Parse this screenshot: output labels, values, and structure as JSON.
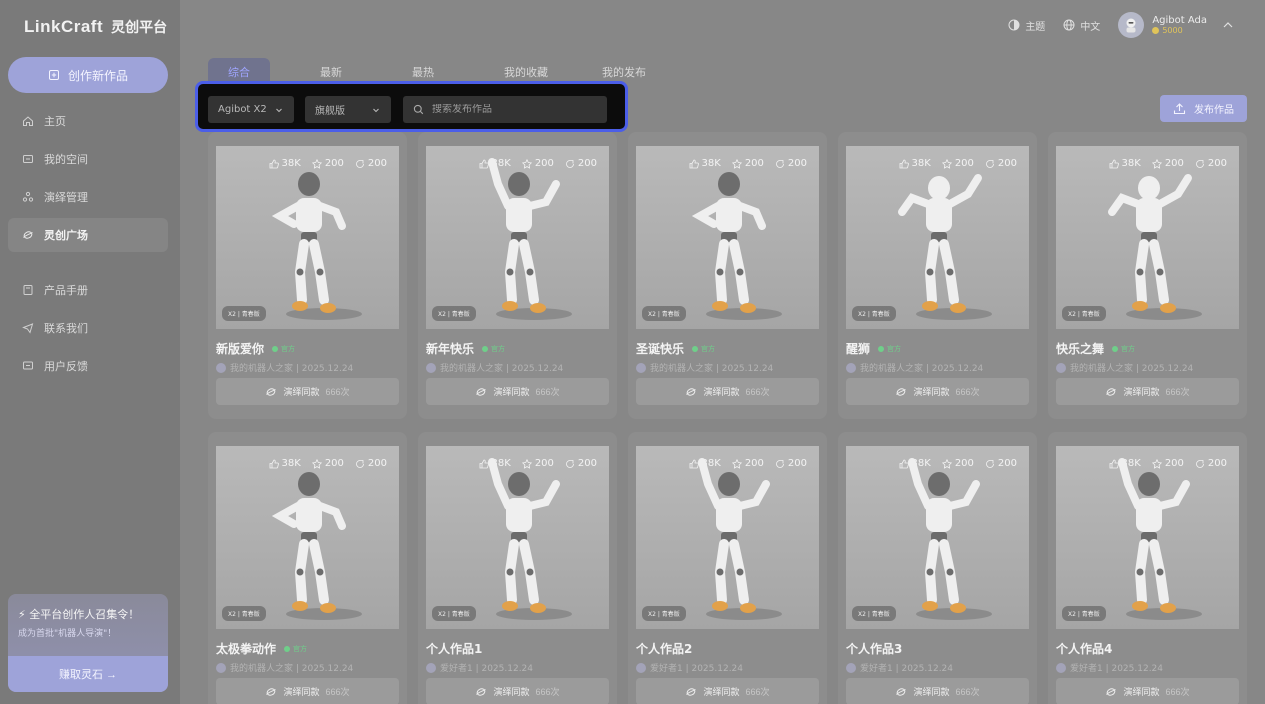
{
  "app": {
    "logo_brand": "LinkCraft",
    "logo_sub": "灵创平台"
  },
  "sidebar": {
    "create_label": "创作新作品",
    "items": [
      {
        "label": "主页",
        "icon": "home-icon"
      },
      {
        "label": "我的空间",
        "icon": "folder-icon"
      },
      {
        "label": "演绎管理",
        "icon": "manage-icon"
      },
      {
        "label": "灵创广场",
        "icon": "plaza-icon"
      },
      {
        "label": "产品手册",
        "icon": "book-icon"
      },
      {
        "label": "联系我们",
        "icon": "send-icon"
      },
      {
        "label": "用户反馈",
        "icon": "feedback-icon"
      }
    ],
    "active_item": "灵创广场",
    "promo": {
      "title": "全平台创作人召集令！",
      "subtitle": "成为首批\"机器人导演\"！",
      "button": "赚取灵石 →"
    }
  },
  "topbar": {
    "theme_label": "主题",
    "lang_label": "中文",
    "user_name": "Agibot Ada",
    "user_coins": "5000"
  },
  "tabs": [
    {
      "label": "综合",
      "active": true
    },
    {
      "label": "最新",
      "active": false
    },
    {
      "label": "最热",
      "active": false
    },
    {
      "label": "我的收藏",
      "active": false
    },
    {
      "label": "我的发布",
      "active": false
    }
  ],
  "filters": {
    "model_select": "Agibot X2",
    "edition_select": "旗舰版",
    "search_placeholder": "搜索发布作品"
  },
  "publish_label": "发布作品",
  "card_common": {
    "likes": "38K",
    "stars": "200",
    "shares": "200",
    "badge": "X2 | 青春版",
    "button_label": "演绎同款",
    "button_count": "666次",
    "official_label": "官方"
  },
  "cards": [
    {
      "title": "新版爱你",
      "official": true,
      "author": "我的机器人之家 | 2025.12.24",
      "pose": "a"
    },
    {
      "title": "新年快乐",
      "official": true,
      "author": "我的机器人之家 | 2025.12.24",
      "pose": "b"
    },
    {
      "title": "圣诞快乐",
      "official": true,
      "author": "我的机器人之家 | 2025.12.24",
      "pose": "a"
    },
    {
      "title": "醒狮",
      "official": true,
      "author": "我的机器人之家 | 2025.12.24",
      "pose": "c"
    },
    {
      "title": "快乐之舞",
      "official": true,
      "author": "我的机器人之家 | 2025.12.24",
      "pose": "c"
    },
    {
      "title": "太极拳动作",
      "official": true,
      "author": "我的机器人之家 | 2025.12.24",
      "pose": "a"
    },
    {
      "title": "个人作品1",
      "official": false,
      "author": "爱好者1 | 2025.12.24",
      "pose": "b"
    },
    {
      "title": "个人作品2",
      "official": false,
      "author": "爱好者1 | 2025.12.24",
      "pose": "b"
    },
    {
      "title": "个人作品3",
      "official": false,
      "author": "爱好者1 | 2025.12.24",
      "pose": "b"
    },
    {
      "title": "个人作品4",
      "official": false,
      "author": "爱好者1 | 2025.12.24",
      "pose": "b"
    }
  ]
}
